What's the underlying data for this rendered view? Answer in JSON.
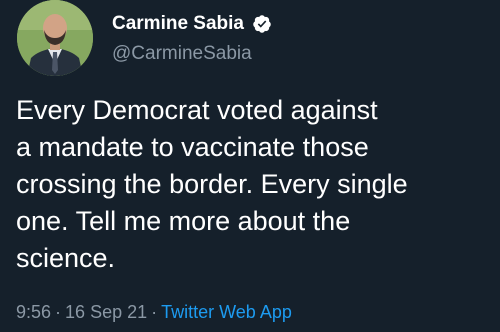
{
  "author": {
    "display_name": "Carmine Sabia",
    "handle": "@CarmineSabia",
    "verified": true
  },
  "tweet": {
    "lines": [
      "Every Democrat voted against",
      "a mandate to vaccinate those",
      "crossing the border. Every single",
      "one. Tell me more about the",
      "science."
    ]
  },
  "meta": {
    "time": "9:56",
    "date": "16 Sep 21",
    "separator": "·",
    "source": "Twitter Web App"
  },
  "colors": {
    "background": "#15202b",
    "text": "#ffffff",
    "secondary_text": "#8b98a5",
    "link": "#1d9bf0",
    "verified_badge": "#ffffff"
  },
  "icons": {
    "verified": "verified-badge-icon"
  }
}
